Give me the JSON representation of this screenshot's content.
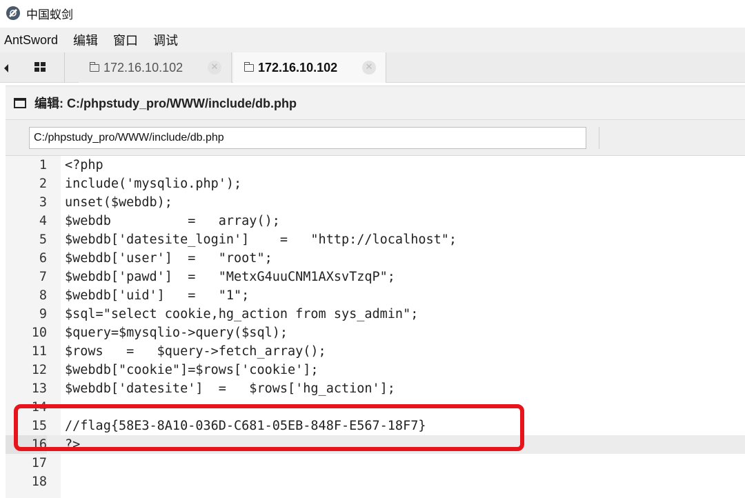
{
  "window": {
    "title": "中国蚁剑"
  },
  "menu": [
    "AntSword",
    "编辑",
    "窗口",
    "调试"
  ],
  "tabs": [
    {
      "label": "172.16.10.102",
      "active": false
    },
    {
      "label": "172.16.10.102",
      "active": true
    }
  ],
  "panel": {
    "title": "编辑: C:/phpstudy_pro/WWW/include/db.php"
  },
  "path_input": {
    "value": "C:/phpstudy_pro/WWW/include/db.php"
  },
  "editor": {
    "lines": [
      {
        "n": "1",
        "text": "<?php"
      },
      {
        "n": "2",
        "text": "include('mysqlio.php');"
      },
      {
        "n": "3",
        "text": "unset($webdb);"
      },
      {
        "n": "4",
        "text": "$webdb          =   array();"
      },
      {
        "n": "5",
        "text": "$webdb['datesite_login']    =   \"http://localhost\";"
      },
      {
        "n": "6",
        "text": "$webdb['user']  =   \"root\";"
      },
      {
        "n": "7",
        "text": "$webdb['pawd']  =   \"MetxG4uuCNM1AXsvTzqP\";"
      },
      {
        "n": "8",
        "text": "$webdb['uid']   =   \"1\";"
      },
      {
        "n": "9",
        "text": "$sql=\"select cookie,hg_action from sys_admin\";"
      },
      {
        "n": "10",
        "text": "$query=$mysqlio->query($sql);"
      },
      {
        "n": "11",
        "text": "$rows   =   $query->fetch_array();"
      },
      {
        "n": "12",
        "text": "$webdb[\"cookie\"]=$rows['cookie'];"
      },
      {
        "n": "13",
        "text": "$webdb['datesite']  =   $rows['hg_action'];"
      },
      {
        "n": "14",
        "text": ""
      },
      {
        "n": "15",
        "text": "//flag{58E3-8A10-036D-C681-05EB-848F-E567-18F7}"
      },
      {
        "n": "16",
        "text": "?>"
      },
      {
        "n": "17",
        "text": ""
      },
      {
        "n": "18",
        "text": ""
      }
    ]
  },
  "colors": {
    "highlight": "#e8141b",
    "keyword": "#3b6ea8",
    "variable": "#c2185b",
    "string": "#8a1a1a",
    "comment": "#8a8a8a"
  },
  "icons": [
    "antsword-logo-icon",
    "grid-icon",
    "folder-icon",
    "close-icon",
    "window-icon"
  ]
}
